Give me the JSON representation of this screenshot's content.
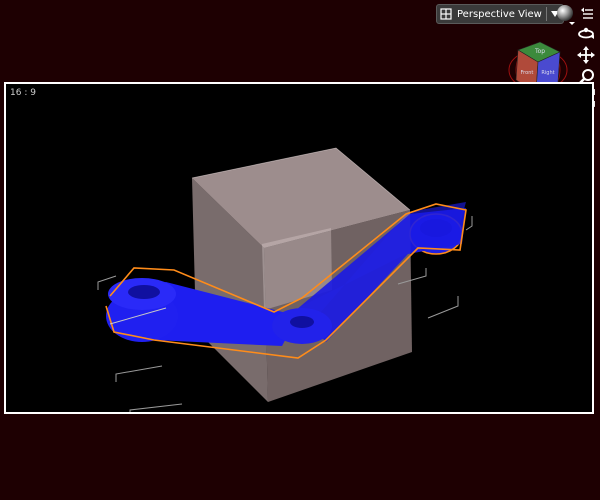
{
  "viewport": {
    "aspect_label": "16 : 9",
    "view_mode_label": "Perspective View",
    "background": "#000000",
    "frame_color": "#ffffff"
  },
  "colors": {
    "window_bg": "#1e0002",
    "part": "#1e1ef0",
    "selection_outline": "#ff8c1a",
    "box": "#c8b4b4"
  },
  "nav_cube": {
    "faces": [
      "Top",
      "Front",
      "Right"
    ]
  },
  "toolbar": {
    "icons": [
      "orbit-icon",
      "pan-icon",
      "zoom-icon",
      "fit-view-icon",
      "look-at-icon"
    ]
  }
}
